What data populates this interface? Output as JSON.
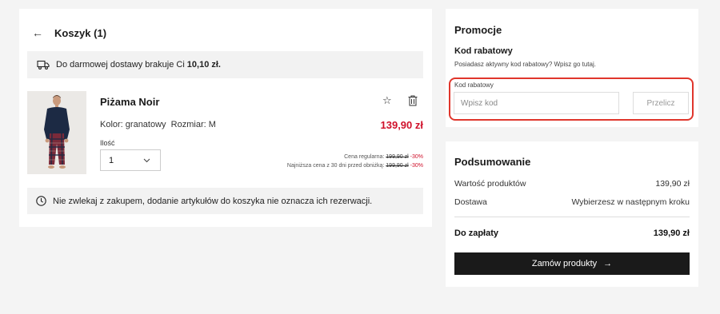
{
  "cart": {
    "back_icon": "arrow-left-icon",
    "title": "Koszyk (1)",
    "delivery_text": "Do darmowej dostawy brakuje Ci",
    "delivery_amount": "10,10 zł.",
    "product": {
      "name": "Piżama Noir",
      "variant": "Kolor: granatowy  Rozmiar: M",
      "price": "139,90 zł",
      "qty_label": "Ilość",
      "qty_value": "1",
      "regular_label": "Cena regularna:",
      "regular_price": "199,90 zł",
      "regular_discount": "-30%",
      "lowest_label": "Najniższa cena z 30 dni przed obniżką:",
      "lowest_price": "199,90 zł",
      "lowest_discount": "-30%"
    },
    "warning_text": "Nie zwlekaj z zakupem, dodanie artykułów do koszyka nie oznacza ich rezerwacji."
  },
  "promo": {
    "title": "Promocje",
    "coupon_title": "Kod rabatowy",
    "coupon_desc": "Posiadasz aktywny kod rabatowy? Wpisz go tutaj.",
    "input_label": "Kod rabatowy",
    "input_placeholder": "Wpisz kod",
    "input_value": "",
    "button_label": "Przelicz"
  },
  "summary": {
    "title": "Podsumowanie",
    "products_label": "Wartość produktów",
    "products_value": "139,90 zł",
    "delivery_label": "Dostawa",
    "delivery_value": "Wybierzesz w następnym kroku",
    "total_label": "Do zapłaty",
    "total_value": "139,90 zł",
    "order_button": "Zamów produkty",
    "order_arrow": "→"
  },
  "colors": {
    "accent_red": "#d0112b",
    "highlight_border": "#e0362c",
    "button_dark": "#1a1a1a",
    "background": "#f4f4f4"
  }
}
